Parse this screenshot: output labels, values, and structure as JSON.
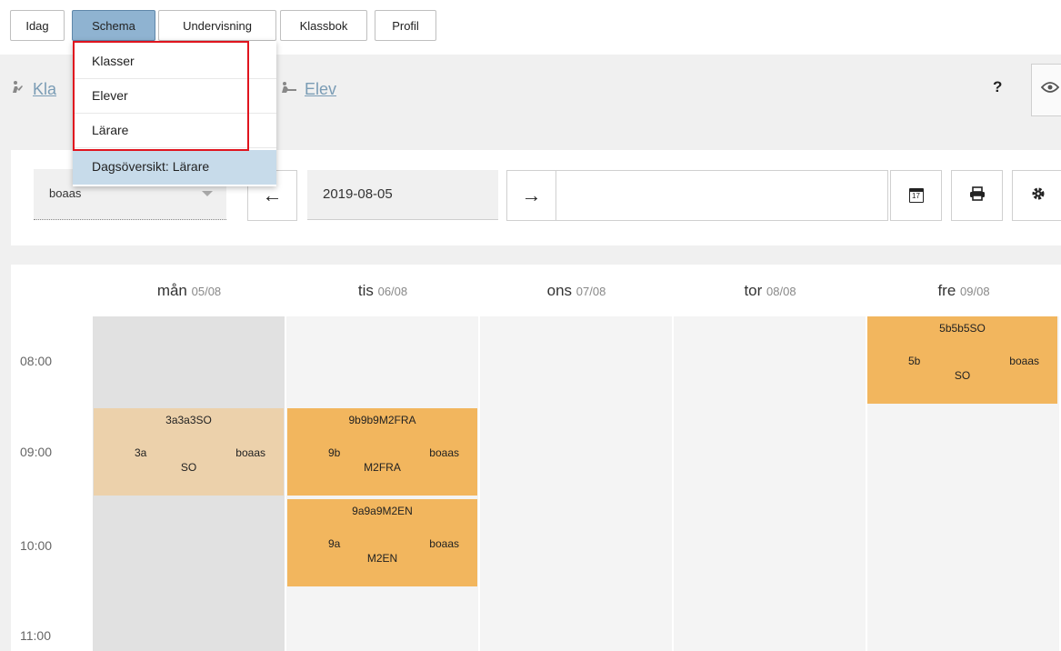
{
  "topnav": {
    "tabs": [
      {
        "label": "Idag"
      },
      {
        "label": "Schema"
      },
      {
        "label": "Undervisning"
      },
      {
        "label": "Klassbok"
      },
      {
        "label": "Profil"
      }
    ]
  },
  "subnav": {
    "links": [
      {
        "label": "Kla",
        "icon": "class-icon"
      },
      {
        "label": "Elev",
        "icon": "student-icon"
      }
    ],
    "help_label": "?"
  },
  "dropdown": {
    "items": [
      {
        "label": "Klasser"
      },
      {
        "label": "Elever"
      },
      {
        "label": "Lärare"
      },
      {
        "label": "Dagsöversikt: Lärare"
      }
    ]
  },
  "controls": {
    "teacher_value": "boaas",
    "date_value": "2019-08-05",
    "prev_icon": "←",
    "next_icon": "→",
    "calendar_icon_text": "17"
  },
  "calendar": {
    "days": [
      {
        "name": "mån",
        "date": "05/08"
      },
      {
        "name": "tis",
        "date": "06/08"
      },
      {
        "name": "ons",
        "date": "07/08"
      },
      {
        "name": "tor",
        "date": "08/08"
      },
      {
        "name": "fre",
        "date": "09/08"
      }
    ],
    "times": [
      "08:00",
      "09:00",
      "10:00",
      "11:00"
    ],
    "events": [
      {
        "title": "5b5b5SO",
        "class": "5b",
        "teacher": "boaas",
        "subject": "SO"
      },
      {
        "title": "3a3a3SO",
        "class": "3a",
        "teacher": "boaas",
        "subject": "SO"
      },
      {
        "title": "9b9b9M2FRA",
        "class": "9b",
        "teacher": "boaas",
        "subject": "M2FRA"
      },
      {
        "title": "9a9a9M2EN",
        "class": "9a",
        "teacher": "boaas",
        "subject": "M2EN"
      }
    ]
  },
  "colors": {
    "active_tab": "#8fb3d1",
    "event": "#f2b65e",
    "event_pale": "#ecd1ab",
    "highlight": "#c7dbea",
    "annotation_box": "#e0141e"
  }
}
